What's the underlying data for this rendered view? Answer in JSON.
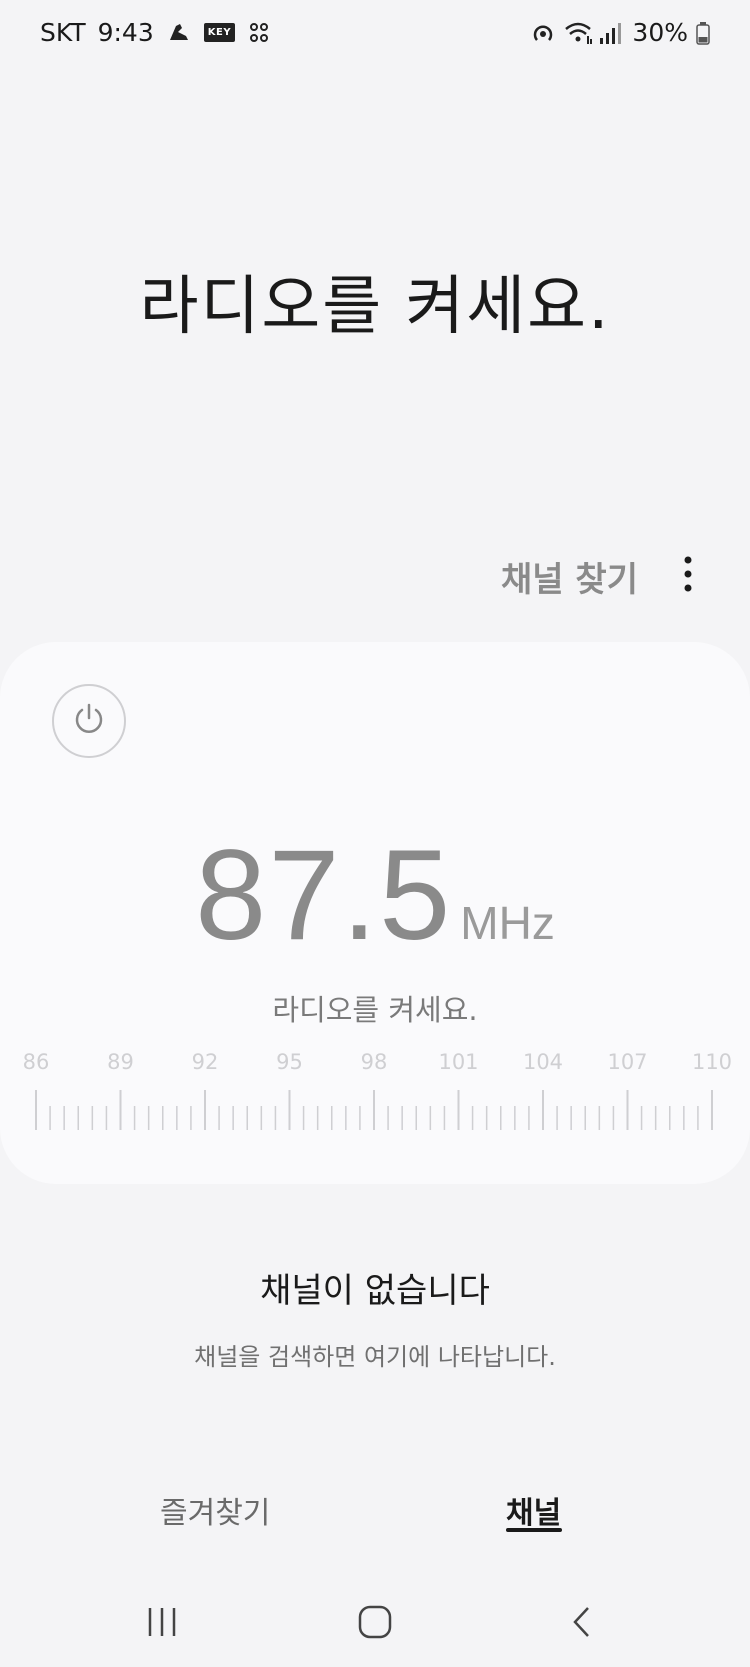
{
  "status_bar": {
    "carrier": "SKT",
    "time": "9:43",
    "key_badge": "KEY",
    "battery": "30%",
    "icons": [
      "shoe-icon",
      "key-icon",
      "grid-icon",
      "hotspot-icon",
      "wifi-icon",
      "signal-icon",
      "battery-icon"
    ]
  },
  "header": {
    "prompt": "라디오를 켜세요."
  },
  "actions": {
    "find_channels": "채널 찾기",
    "more_icon": "more-vertical-icon"
  },
  "tuner": {
    "power_icon": "power-icon",
    "frequency": "87.5",
    "unit": "MHz",
    "status": "라디오를 켜세요.",
    "dial_labels": [
      "86",
      "89",
      "92",
      "95",
      "98",
      "101",
      "104",
      "107",
      "110"
    ],
    "dial_min": 86,
    "dial_max": 110
  },
  "empty_state": {
    "title": "채널이 없습니다",
    "description": "채널을 검색하면 여기에 나타납니다."
  },
  "tabs": {
    "favorites": "즐겨찾기",
    "channels": "채널",
    "active": "channels"
  },
  "nav": {
    "recents_icon": "recents-icon",
    "home_icon": "home-icon",
    "back_icon": "back-icon"
  },
  "colors": {
    "background": "#f4f4f6",
    "card": "#fafafc",
    "frequency": "#8a8a8a",
    "dial_ticks": "#cfcfd2"
  }
}
